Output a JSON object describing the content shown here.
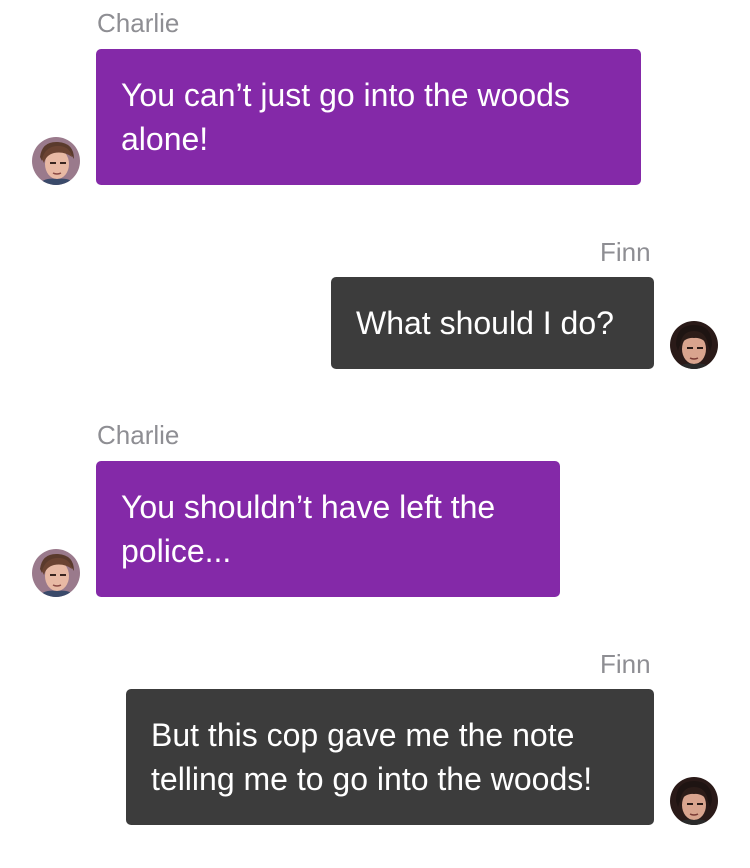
{
  "messages": [
    {
      "sender": "Charlie",
      "text": "You can’t just go into the woods alone!",
      "side": "left",
      "color": "#8429a8",
      "avatar": "charlie-avatar"
    },
    {
      "sender": "Finn",
      "text": "What should I do?",
      "side": "right",
      "color": "#3c3c3c",
      "avatar": "finn-avatar"
    },
    {
      "sender": "Charlie",
      "text": "You shouldn’t have left the police...",
      "side": "left",
      "color": "#8429a8",
      "avatar": "charlie-avatar"
    },
    {
      "sender": "Finn",
      "text": "But this cop gave me the note telling me to go into the woods!",
      "side": "right",
      "color": "#3c3c3c",
      "avatar": "finn-avatar"
    }
  ]
}
